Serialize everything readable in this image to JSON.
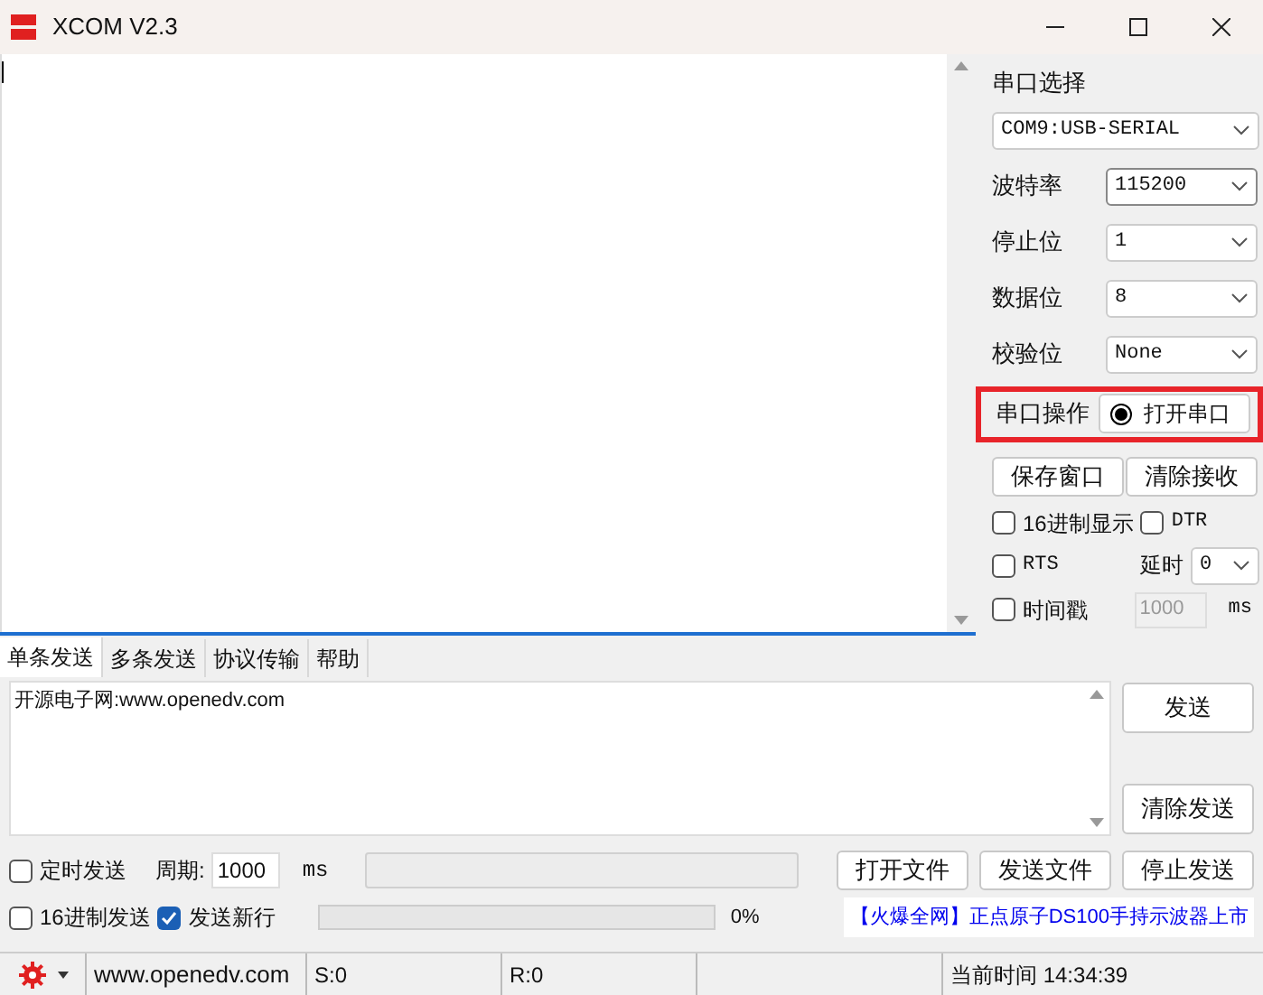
{
  "window": {
    "title": "XCOM V2.3"
  },
  "serial_panel": {
    "port_label": "串口选择",
    "port": "COM9:USB-SERIAL",
    "settings": [
      {
        "label": "波特率",
        "value": "115200",
        "focused": true
      },
      {
        "label": "停止位",
        "value": "1",
        "focused": false
      },
      {
        "label": "数据位",
        "value": "8",
        "focused": false
      },
      {
        "label": "校验位",
        "value": "None",
        "focused": false
      }
    ],
    "operation": {
      "label": "串口操作",
      "button": "打开串口",
      "highlighted": true
    },
    "buttons": [
      "保存窗口",
      "清除接收"
    ],
    "hex_display": {
      "label": "16进制显示",
      "checked": false
    },
    "dtr": {
      "label": "DTR",
      "checked": false
    },
    "rts": {
      "label": "RTS",
      "checked": false
    },
    "delay": {
      "label": "延时",
      "value": "0"
    },
    "timestamp": {
      "label": "时间戳",
      "checked": false,
      "value": "1000",
      "unit": "ms"
    }
  },
  "tabs": [
    {
      "label": "单条发送",
      "selected": true
    },
    {
      "label": "多条发送",
      "selected": false
    },
    {
      "label": "协议传输",
      "selected": false
    },
    {
      "label": "帮助",
      "selected": false
    }
  ],
  "send": {
    "text": "开源电子网:www.openedv.com",
    "buttons": [
      "发送",
      "清除发送"
    ]
  },
  "timed_send": {
    "label": "定时发送",
    "checked": false,
    "period_label": "周期:",
    "period": "1000",
    "unit": "ms"
  },
  "file_buttons": [
    "打开文件",
    "发送文件",
    "停止发送"
  ],
  "hex_send": {
    "label": "16进制发送",
    "checked": false
  },
  "send_newline": {
    "label": "发送新行",
    "checked": true
  },
  "progress": {
    "level": 0,
    "reading": "0%"
  },
  "marquee": "【火爆全网】正点原子DS100手持示波器上市",
  "status_bar": {
    "site": "www.openedv.com",
    "sent": "S:0",
    "received": "R:0",
    "time": "当前时间 14:34:39"
  }
}
